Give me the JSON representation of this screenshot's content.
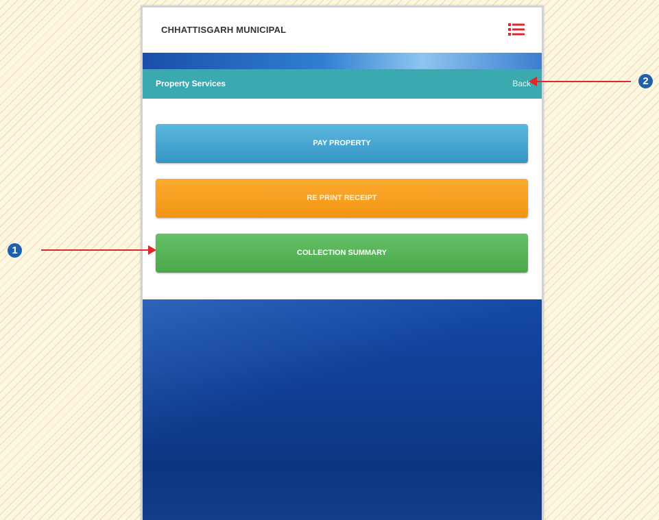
{
  "app": {
    "title": "CHHATTISGARH MUNICIPAL"
  },
  "service_bar": {
    "title": "Property Services",
    "back_label": "Back"
  },
  "buttons": {
    "pay_property": "PAY PROPERTY",
    "reprint_receipt": "RE PRINT RECEIPT",
    "collection_summary": "COLLECTION SUMMARY"
  },
  "annotations": {
    "marker_1": "1",
    "marker_2": "2"
  },
  "icons": {
    "menu": "list-menu-icon"
  },
  "colors": {
    "service_bar": "#3aa9b0",
    "pay_button": "#4aa9d4",
    "reprint_button": "#f7a01f",
    "collection_button": "#58b558",
    "menu_icon": "#e0252b",
    "annotation_arrow": "#e0252b",
    "annotation_marker": "#1e5fae"
  }
}
